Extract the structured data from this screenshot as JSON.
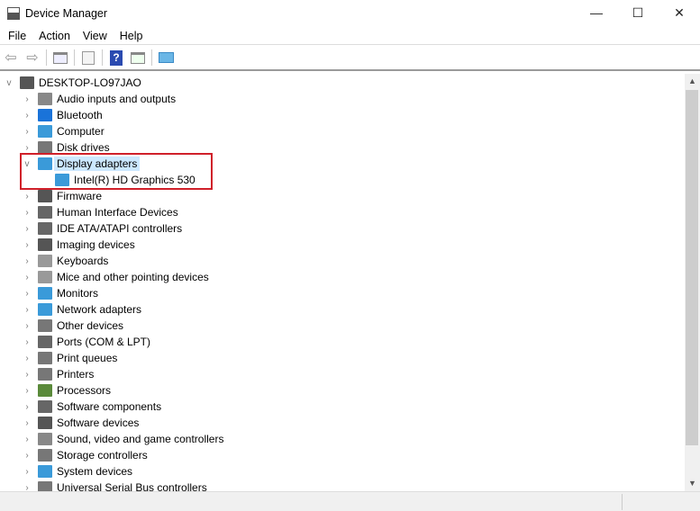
{
  "window": {
    "title": "Device Manager",
    "minimize": "—",
    "maximize": "☐",
    "close": "✕"
  },
  "menu": [
    "File",
    "Action",
    "View",
    "Help"
  ],
  "toolbar": [
    "back-icon",
    "forward-icon",
    "show-hide-console-tree-icon",
    "properties-icon",
    "help-icon",
    "action-pane-icon",
    "scan-hardware-icon"
  ],
  "tree": {
    "root": "DESKTOP-LO97JAO",
    "items": [
      {
        "label": "Audio inputs and outputs",
        "color": "#888"
      },
      {
        "label": "Bluetooth",
        "color": "#1a73d9"
      },
      {
        "label": "Computer",
        "color": "#3a9ad9"
      },
      {
        "label": "Disk drives",
        "color": "#777"
      },
      {
        "label": "Display adapters",
        "color": "#3a9ad9",
        "expanded": true,
        "selected": true,
        "children": [
          "Intel(R) HD Graphics 530"
        ]
      },
      {
        "label": "Firmware",
        "color": "#555"
      },
      {
        "label": "Human Interface Devices",
        "color": "#666"
      },
      {
        "label": "IDE ATA/ATAPI controllers",
        "color": "#666"
      },
      {
        "label": "Imaging devices",
        "color": "#555"
      },
      {
        "label": "Keyboards",
        "color": "#999"
      },
      {
        "label": "Mice and other pointing devices",
        "color": "#999"
      },
      {
        "label": "Monitors",
        "color": "#3a9ad9"
      },
      {
        "label": "Network adapters",
        "color": "#3a9ad9"
      },
      {
        "label": "Other devices",
        "color": "#777"
      },
      {
        "label": "Ports (COM & LPT)",
        "color": "#666"
      },
      {
        "label": "Print queues",
        "color": "#777"
      },
      {
        "label": "Printers",
        "color": "#777"
      },
      {
        "label": "Processors",
        "color": "#5a8a3a"
      },
      {
        "label": "Software components",
        "color": "#666"
      },
      {
        "label": "Software devices",
        "color": "#555"
      },
      {
        "label": "Sound, video and game controllers",
        "color": "#888"
      },
      {
        "label": "Storage controllers",
        "color": "#777"
      },
      {
        "label": "System devices",
        "color": "#3a9ad9"
      },
      {
        "label": "Universal Serial Bus controllers",
        "color": "#777"
      }
    ]
  },
  "highlight_color": "#d0202a"
}
